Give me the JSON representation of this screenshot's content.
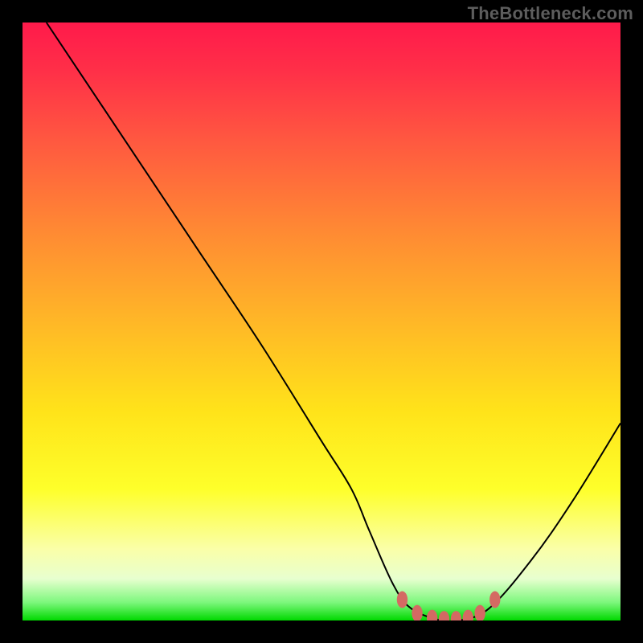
{
  "watermark": "TheBottleneck.com",
  "chart_data": {
    "type": "line",
    "title": "",
    "xlabel": "",
    "ylabel": "",
    "xlim": [
      0,
      100
    ],
    "ylim": [
      0,
      100
    ],
    "grid": false,
    "legend": false,
    "series": [
      {
        "name": "bottleneck-curve",
        "x": [
          4,
          10,
          20,
          30,
          40,
          50,
          55,
          58,
          62,
          65,
          70,
          73,
          78,
          85,
          92,
          100
        ],
        "y": [
          100,
          91,
          76,
          61,
          46,
          30,
          22,
          15,
          6,
          2,
          0,
          0,
          2,
          10,
          20,
          33
        ]
      }
    ],
    "markers": {
      "name": "optimal-range-markers",
      "color": "#d46a63",
      "points": [
        {
          "x": 63.5,
          "y": 3.5
        },
        {
          "x": 66,
          "y": 1.2
        },
        {
          "x": 68.5,
          "y": 0.4
        },
        {
          "x": 70.5,
          "y": 0.2
        },
        {
          "x": 72.5,
          "y": 0.2
        },
        {
          "x": 74.5,
          "y": 0.4
        },
        {
          "x": 76.5,
          "y": 1.2
        },
        {
          "x": 79,
          "y": 3.5
        }
      ]
    },
    "background_gradient": {
      "top": "#ff1a4b",
      "mid": "#ffe31a",
      "bottom": "#00d900"
    }
  }
}
